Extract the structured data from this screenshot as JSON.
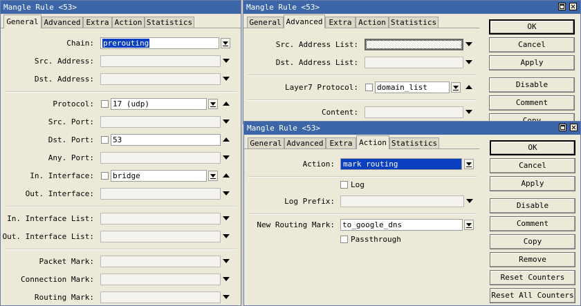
{
  "windows": {
    "general": {
      "title": "Mangle Rule <53>",
      "tabs": [
        "General",
        "Advanced",
        "Extra",
        "Action",
        "Statistics"
      ],
      "fields": {
        "chain": {
          "label": "Chain:",
          "value": "prerouting"
        },
        "src_address": {
          "label": "Src. Address:",
          "value": ""
        },
        "dst_address": {
          "label": "Dst. Address:",
          "value": ""
        },
        "protocol": {
          "label": "Protocol:",
          "value": "17 (udp)"
        },
        "src_port": {
          "label": "Src. Port:",
          "value": ""
        },
        "dst_port": {
          "label": "Dst. Port:",
          "value": "53"
        },
        "any_port": {
          "label": "Any. Port:",
          "value": ""
        },
        "in_interface": {
          "label": "In. Interface:",
          "value": "bridge"
        },
        "out_interface": {
          "label": "Out. Interface:",
          "value": ""
        },
        "in_interface_list": {
          "label": "In. Interface List:",
          "value": ""
        },
        "out_interface_list": {
          "label": "Out. Interface List:",
          "value": ""
        },
        "packet_mark": {
          "label": "Packet Mark:",
          "value": ""
        },
        "connection_mark": {
          "label": "Connection Mark:",
          "value": ""
        },
        "routing_mark": {
          "label": "Routing Mark:",
          "value": ""
        }
      }
    },
    "advanced": {
      "title": "Mangle Rule <53>",
      "tabs": [
        "General",
        "Advanced",
        "Extra",
        "Action",
        "Statistics"
      ],
      "fields": {
        "src_address_list": {
          "label": "Src. Address List:",
          "value": ""
        },
        "dst_address_list": {
          "label": "Dst. Address List:",
          "value": ""
        },
        "layer7_protocol": {
          "label": "Layer7 Protocol:",
          "value": "domain_list"
        },
        "content": {
          "label": "Content:",
          "value": ""
        }
      },
      "buttons": [
        "OK",
        "Cancel",
        "Apply",
        "Disable",
        "Comment",
        "Copy"
      ]
    },
    "action": {
      "title": "Mangle Rule <53>",
      "tabs": [
        "General",
        "Advanced",
        "Extra",
        "Action",
        "Statistics"
      ],
      "fields": {
        "action": {
          "label": "Action:",
          "value": "mark routing"
        },
        "log": {
          "label": "Log"
        },
        "log_prefix": {
          "label": "Log Prefix:",
          "value": ""
        },
        "new_routing_mark": {
          "label": "New Routing Mark:",
          "value": "to_google_dns"
        },
        "passthrough": {
          "label": "Passthrough"
        }
      },
      "buttons": [
        "OK",
        "Cancel",
        "Apply",
        "Disable",
        "Comment",
        "Copy",
        "Remove",
        "Reset Counters",
        "Reset All Counters"
      ]
    }
  },
  "colors": {
    "titlebar": "#3d66a8",
    "selection": "#0a3fbf",
    "window_bg": "#ece9d8"
  }
}
